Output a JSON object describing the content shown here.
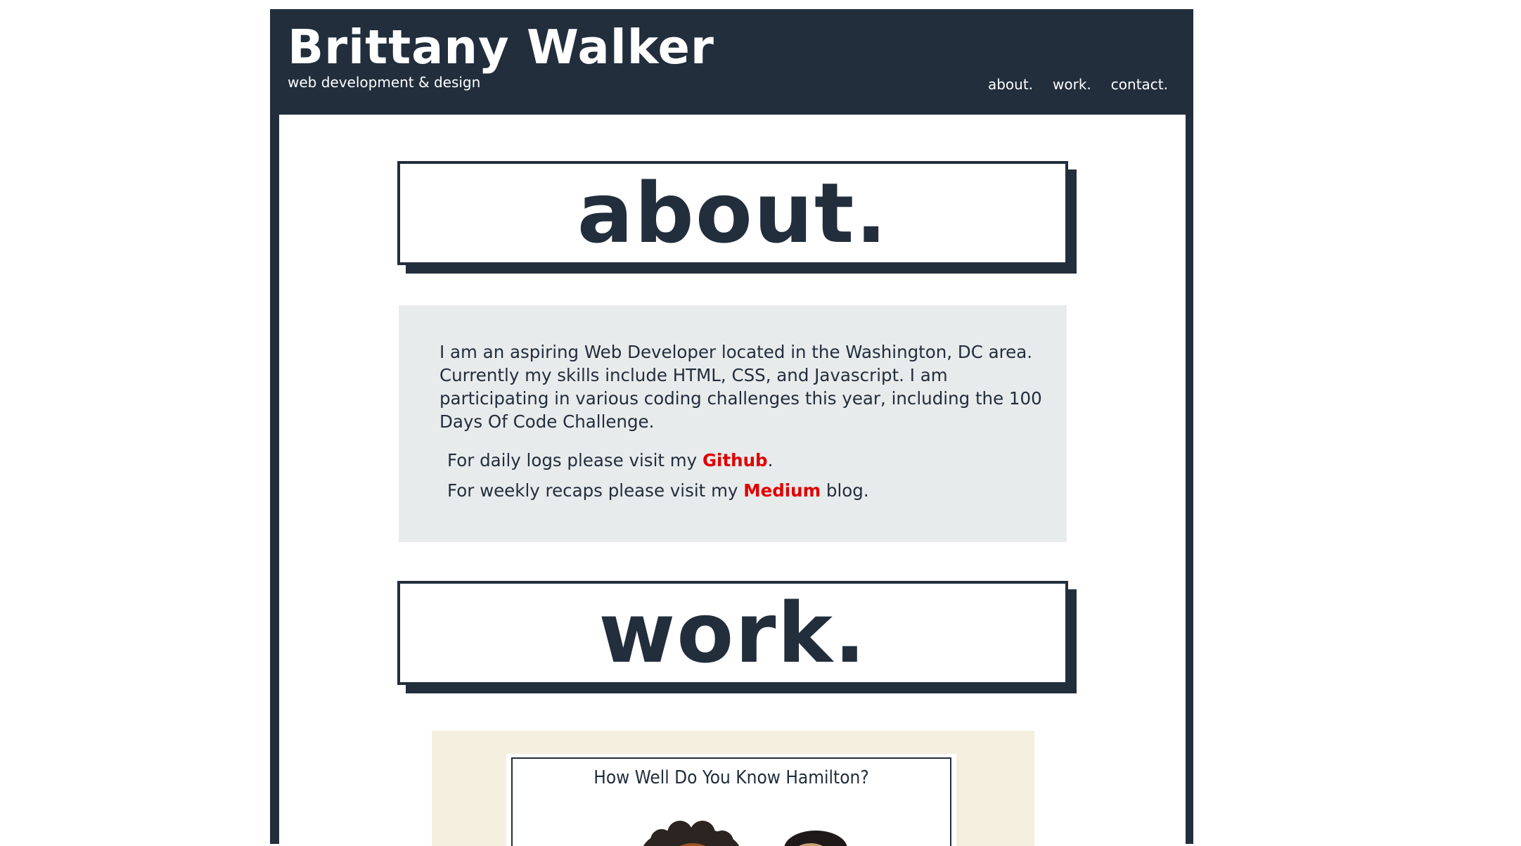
{
  "header": {
    "title": "Brittany Walker",
    "subtitle": "web development & design",
    "nav": [
      "about.",
      "work.",
      "contact."
    ]
  },
  "about": {
    "heading": "about.",
    "bio_lines": [
      "I am an aspiring Web Developer located in the Washington, DC area.",
      "Currently my skills include HTML, CSS, and Javascript. I am",
      "participating in various coding challenges this year, including the 100",
      "Days Of Code Challenge."
    ],
    "github_prefix": "For daily logs please visit my ",
    "github_link": "Github",
    "github_suffix": ".",
    "medium_prefix": "For weekly recaps please visit my ",
    "medium_link": "Medium",
    "medium_suffix": " blog."
  },
  "work": {
    "heading": "work.",
    "project_title": "How Well Do You Know Hamilton?"
  },
  "colors": {
    "navy": "#222e3c",
    "link_red": "#e00000",
    "card_gray": "#e8ebec",
    "project_beige": "#f4efdf"
  }
}
